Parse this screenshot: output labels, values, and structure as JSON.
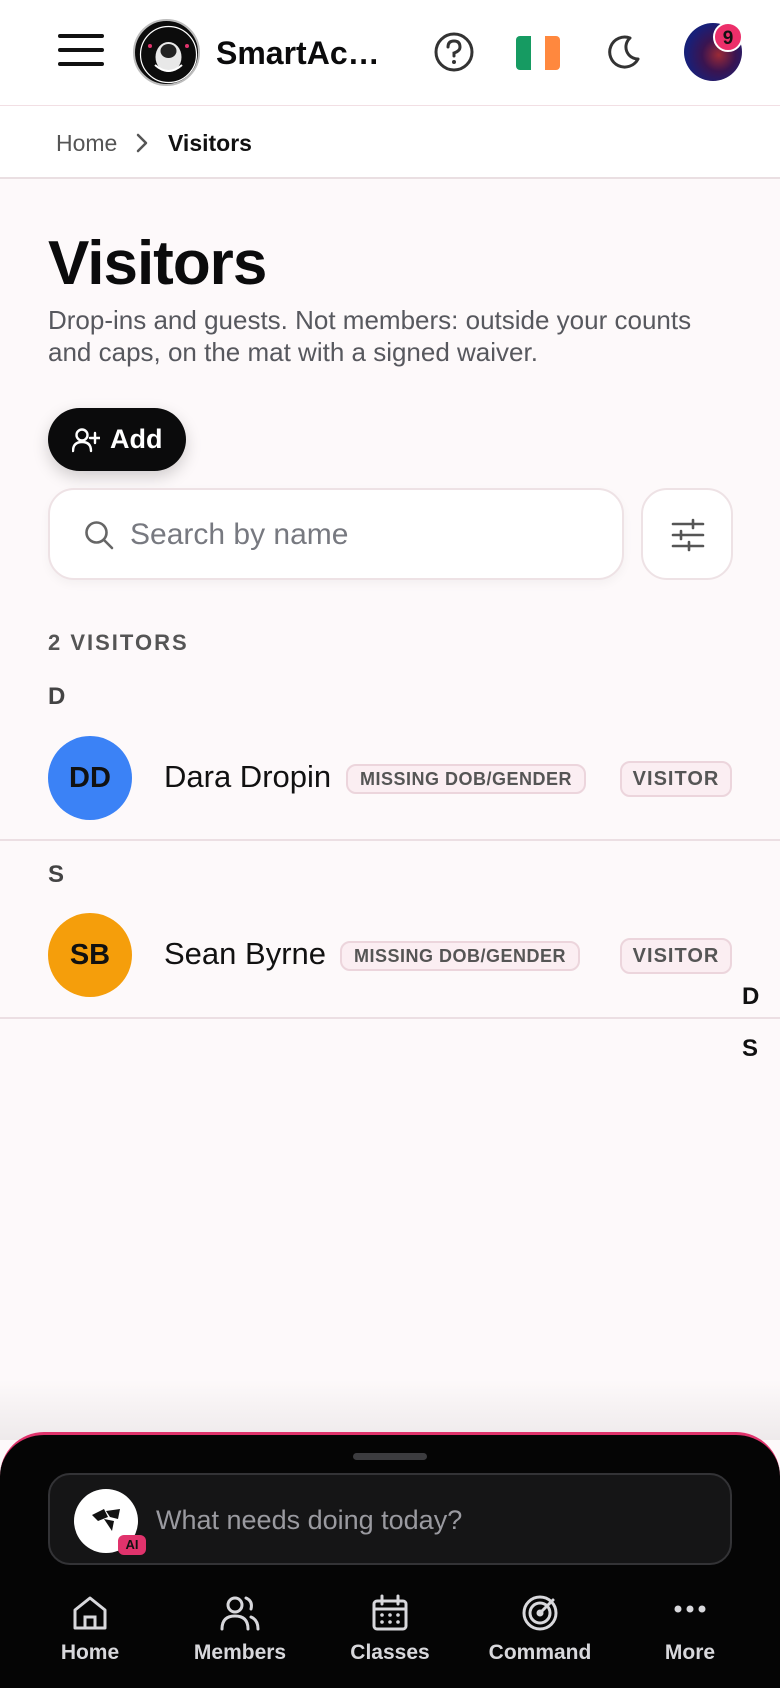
{
  "header": {
    "app_name": "SmartAcademy",
    "notification_count": "9",
    "flag_colors": [
      "#169b62",
      "#ffffff",
      "#ff883e"
    ]
  },
  "breadcrumb": {
    "home": "Home",
    "current": "Visitors"
  },
  "page": {
    "title": "Visitors",
    "description": "Drop-ins and guests. Not members: outside your counts and caps, on the mat with a signed waiver.",
    "add_label": "Add",
    "search_placeholder": "Search by name"
  },
  "list": {
    "count_label": "2 VISITORS",
    "groups": [
      {
        "letter": "D",
        "visitor": {
          "initials": "DD",
          "name": "Dara Dropin",
          "warning": "MISSING DOB/GENDER",
          "type": "VISITOR",
          "avatar_color": "#3b82f6"
        }
      },
      {
        "letter": "S",
        "visitor": {
          "initials": "SB",
          "name": "Sean Byrne",
          "warning": "MISSING DOB/GENDER",
          "type": "VISITOR",
          "avatar_color": "#f59e0b"
        }
      }
    ],
    "index_letters": [
      "D",
      "S"
    ]
  },
  "assistant": {
    "placeholder": "What needs doing today?",
    "tag": "AI",
    "accent": "#e0336c"
  },
  "bottom_nav": [
    {
      "label": "Home",
      "icon": "home-icon"
    },
    {
      "label": "Members",
      "icon": "members-icon"
    },
    {
      "label": "Classes",
      "icon": "calendar-icon"
    },
    {
      "label": "Command",
      "icon": "radar-icon"
    },
    {
      "label": "More",
      "icon": "more-icon"
    }
  ]
}
